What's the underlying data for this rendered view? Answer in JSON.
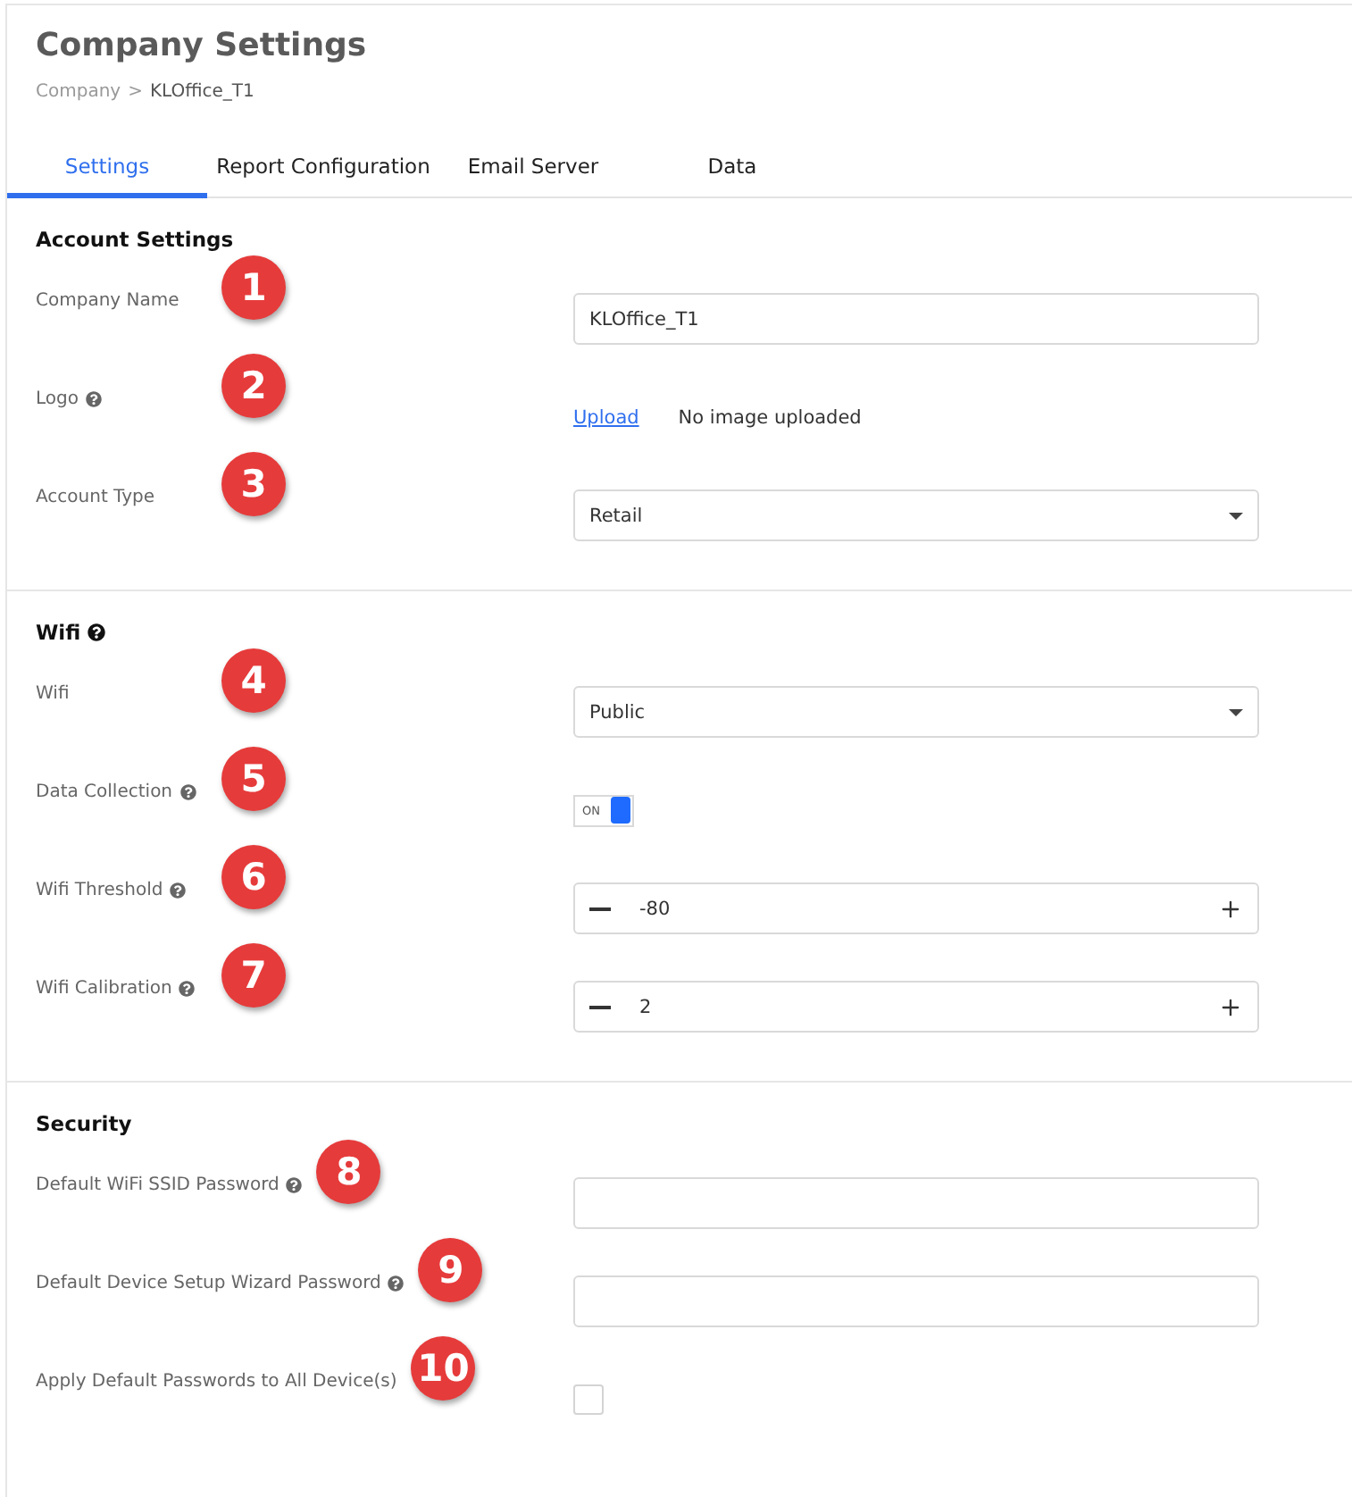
{
  "title": "Company Settings",
  "breadcrumb": {
    "parent": "Company",
    "separator": ">",
    "current": "KLOffice_T1"
  },
  "tabs": [
    {
      "label": "Settings",
      "selected": true
    },
    {
      "label": "Report Configuration",
      "selected": false
    },
    {
      "label": "Email Server",
      "selected": false
    },
    {
      "label": "Data",
      "selected": false
    }
  ],
  "sections": [
    {
      "heading": "Account Settings",
      "help": false,
      "rows": [
        {
          "kind": "text",
          "label": "Company Name",
          "help": false,
          "badge": "1",
          "value": "KLOffice_T1"
        },
        {
          "kind": "upload",
          "label": "Logo",
          "help": true,
          "badge": "2",
          "link": "Upload",
          "status": "No image uploaded"
        },
        {
          "kind": "select",
          "label": "Account Type",
          "help": false,
          "badge": "3",
          "value": "Retail"
        }
      ]
    },
    {
      "heading": "Wifi",
      "help": true,
      "rows": [
        {
          "kind": "select",
          "label": "Wifi",
          "help": false,
          "badge": "4",
          "value": "Public"
        },
        {
          "kind": "toggle",
          "label": "Data Collection",
          "help": true,
          "badge": "5",
          "on": true,
          "text": "ON"
        },
        {
          "kind": "stepper",
          "label": "Wifi Threshold",
          "help": true,
          "badge": "6",
          "value": "-80"
        },
        {
          "kind": "stepper",
          "label": "Wifi Calibration",
          "help": true,
          "badge": "7",
          "value": "2"
        }
      ]
    },
    {
      "heading": "Security",
      "help": false,
      "rows": [
        {
          "kind": "text",
          "label": "Default WiFi SSID Password",
          "help": true,
          "badge": "8",
          "value": ""
        },
        {
          "kind": "text",
          "label": "Default Device Setup Wizard Password",
          "help": true,
          "badge": "9",
          "value": ""
        },
        {
          "kind": "checkbox",
          "label": "Apply Default Passwords to All Device(s)",
          "help": false,
          "badge": "10",
          "checked": false
        }
      ]
    }
  ]
}
